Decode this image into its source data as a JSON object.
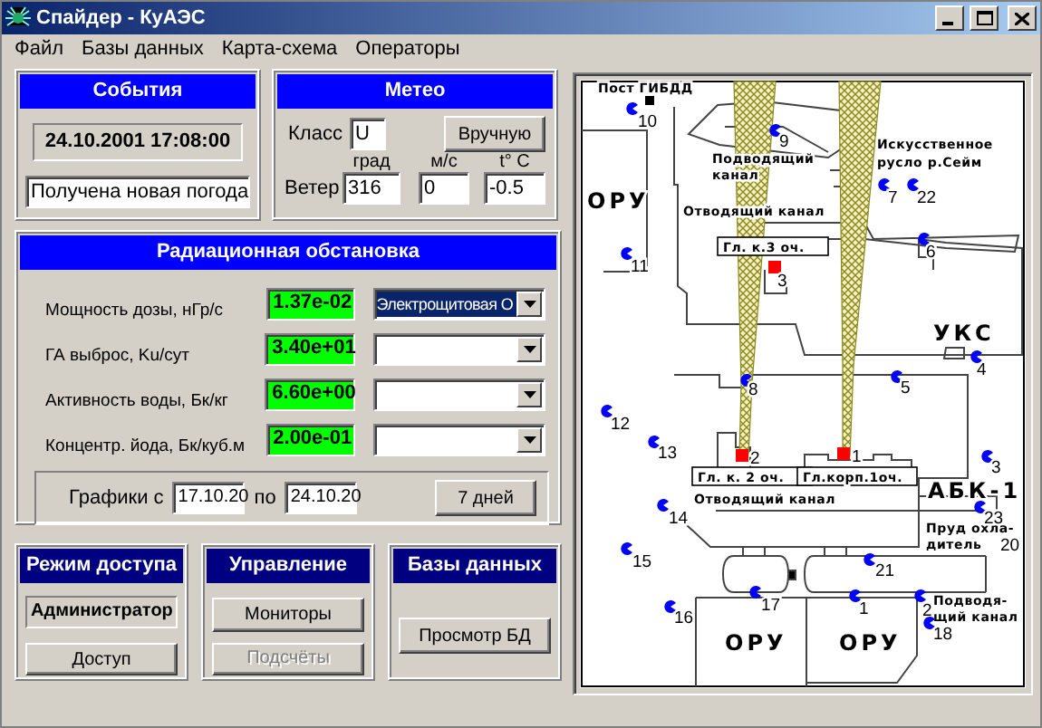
{
  "window": {
    "title": "Спайдер - КуАЭС"
  },
  "menu": [
    "Файл",
    "Базы данных",
    "Карта-схема",
    "Операторы"
  ],
  "events": {
    "title": "События",
    "datetime": "24.10.2001 17:08:00",
    "message": "Получена новая погода"
  },
  "meteo": {
    "title": "Метео",
    "class_label": "Класс",
    "class_value": "U",
    "manual_button": "Вручную",
    "wind_label": "Ветер",
    "columns": [
      {
        "unit": "град",
        "value": "316"
      },
      {
        "unit": "м/с",
        "value": "0"
      },
      {
        "unit": "t° C",
        "value": "-0.5"
      }
    ]
  },
  "radiation": {
    "title": "Радиационная обстановка",
    "rows": [
      {
        "label": "Мощность дозы, нГр/с",
        "value": "1.37e-02",
        "selection": "Электрощитовая О"
      },
      {
        "label": "ГА выброс, Ku/сут",
        "value": "3.40e+01"
      },
      {
        "label": "Активность воды, Бк/кг",
        "value": "6.60e+00"
      },
      {
        "label": "Концентр. йода, Бк/куб.м",
        "value": "2.00e-01"
      }
    ],
    "graphs": {
      "from_label": "Графики с",
      "from": "17.10.20",
      "to_label": "по",
      "to": "24.10.20",
      "button": "7 дней"
    }
  },
  "access": {
    "title": "Режим доступа",
    "user": "Администратор",
    "button": "Доступ"
  },
  "control": {
    "title": "Управление",
    "buttons": [
      {
        "label": "Мониторы",
        "disabled": false
      },
      {
        "label": "Подсчёты",
        "disabled": true
      }
    ]
  },
  "databases": {
    "title": "Базы данных",
    "button": "Просмотр БД"
  },
  "map": {
    "labels": [
      {
        "text": "Пост ГИБДД",
        "kind": "small"
      },
      {
        "text": "Подводящий",
        "kind": "small"
      },
      {
        "text": "канал",
        "kind": "small"
      },
      {
        "text": "Искусственное",
        "kind": "small"
      },
      {
        "text": "русло р.Сейм",
        "kind": "small"
      },
      {
        "text": "ОРУ",
        "kind": "large"
      },
      {
        "text": "Отводящий канал",
        "kind": "small"
      },
      {
        "text": "Гл. к.3 оч.",
        "kind": "boxed"
      },
      {
        "text": "УКС",
        "kind": "large"
      },
      {
        "text": "Гл. к. 2 оч.",
        "kind": "boxed"
      },
      {
        "text": "Гл.корп.1оч.",
        "kind": "boxed"
      },
      {
        "text": "АБК-1",
        "kind": "large"
      },
      {
        "text": "Отводящий канал",
        "kind": "small"
      },
      {
        "text": "Пруд охла-",
        "kind": "small"
      },
      {
        "text": "дитель",
        "kind": "small"
      },
      {
        "text": "Подводя-",
        "kind": "small"
      },
      {
        "text": "щий канал",
        "kind": "small"
      },
      {
        "text": "ОРУ",
        "kind": "large"
      },
      {
        "text": "ОРУ",
        "kind": "large"
      }
    ],
    "sensors": [
      {
        "number": "10",
        "kind": "detector"
      },
      {
        "number": "9",
        "kind": "detector"
      },
      {
        "number": "7",
        "kind": "detector"
      },
      {
        "number": "22",
        "kind": "detector"
      },
      {
        "number": "6",
        "kind": "detector"
      },
      {
        "number": "11",
        "kind": "detector"
      },
      {
        "number": "3",
        "kind": "source"
      },
      {
        "number": "4",
        "kind": "detector"
      },
      {
        "number": "8",
        "kind": "detector"
      },
      {
        "number": "5",
        "kind": "detector"
      },
      {
        "number": "12",
        "kind": "detector"
      },
      {
        "number": "13",
        "kind": "detector"
      },
      {
        "number": "3",
        "kind": "detector"
      },
      {
        "number": "2",
        "kind": "source"
      },
      {
        "number": "1",
        "kind": "source"
      },
      {
        "number": "23",
        "kind": "detector"
      },
      {
        "number": "20",
        "kind": "number"
      },
      {
        "number": "14",
        "kind": "detector"
      },
      {
        "number": "15",
        "kind": "detector"
      },
      {
        "number": "21",
        "kind": "detector"
      },
      {
        "number": "17",
        "kind": "detector"
      },
      {
        "number": "1",
        "kind": "detector"
      },
      {
        "number": "2",
        "kind": "detector"
      },
      {
        "number": "16",
        "kind": "detector"
      },
      {
        "number": "18",
        "kind": "detector"
      }
    ]
  }
}
